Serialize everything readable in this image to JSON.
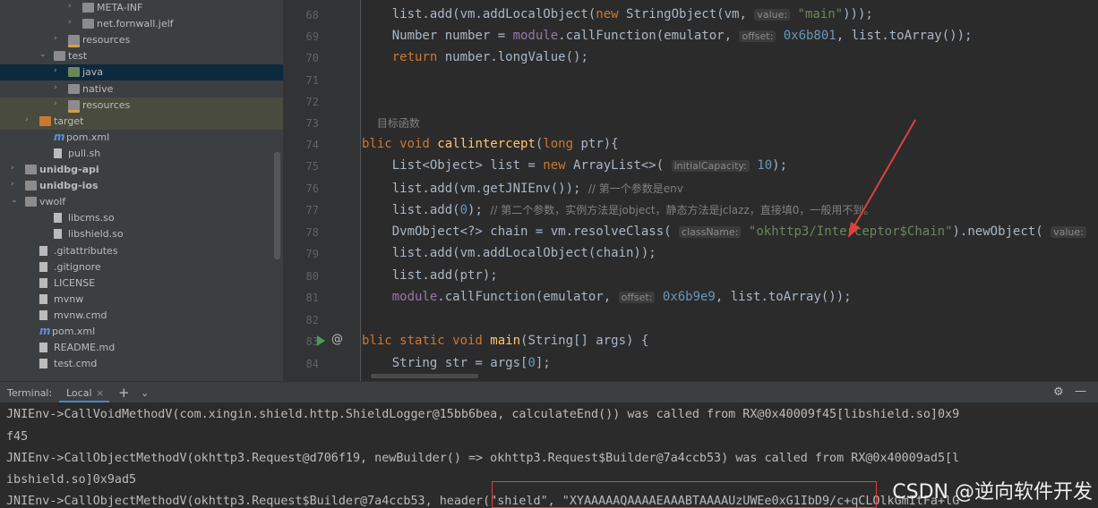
{
  "project_tree": [
    {
      "label": "META-INF",
      "indent": 92,
      "type": "folder",
      "arrow": "›"
    },
    {
      "label": "net.fornwall.jelf",
      "indent": 92,
      "type": "folder",
      "arrow": "›"
    },
    {
      "label": "resources",
      "indent": 76,
      "type": "res",
      "arrow": "›"
    },
    {
      "label": "test",
      "indent": 60,
      "type": "folder",
      "arrow": "⌄"
    },
    {
      "label": "java",
      "indent": 76,
      "type": "green",
      "arrow": "›",
      "sel": true
    },
    {
      "label": "native",
      "indent": 76,
      "type": "folder",
      "arrow": "›"
    },
    {
      "label": "resources",
      "indent": 76,
      "type": "res",
      "arrow": "›",
      "hl": true
    },
    {
      "label": "target",
      "indent": 44,
      "type": "orange",
      "arrow": "›",
      "hl": true
    },
    {
      "label": "pom.xml",
      "indent": 60,
      "type": "m"
    },
    {
      "label": "pull.sh",
      "indent": 60,
      "type": "file"
    },
    {
      "label": "unidbg-api",
      "indent": 28,
      "type": "folder",
      "arrow": "›",
      "bold": true
    },
    {
      "label": "unidbg-ios",
      "indent": 28,
      "type": "folder",
      "arrow": "›",
      "bold": true
    },
    {
      "label": "vwolf",
      "indent": 28,
      "type": "folder",
      "arrow": "⌄"
    },
    {
      "label": "libcms.so",
      "indent": 60,
      "type": "file"
    },
    {
      "label": "libshield.so",
      "indent": 60,
      "type": "file"
    },
    {
      "label": ".gitattributes",
      "indent": 44,
      "type": "file"
    },
    {
      "label": ".gitignore",
      "indent": 44,
      "type": "file"
    },
    {
      "label": "LICENSE",
      "indent": 44,
      "type": "file"
    },
    {
      "label": "mvnw",
      "indent": 44,
      "type": "file"
    },
    {
      "label": "mvnw.cmd",
      "indent": 44,
      "type": "file"
    },
    {
      "label": "pom.xml",
      "indent": 44,
      "type": "m"
    },
    {
      "label": "README.md",
      "indent": 44,
      "type": "file"
    },
    {
      "label": "test.cmd",
      "indent": 44,
      "type": "file"
    }
  ],
  "editor": {
    "line_numbers": [
      "68",
      "69",
      "70",
      "71",
      "72",
      "73",
      "74",
      "75",
      "76",
      "77",
      "78",
      "79",
      "80",
      "81",
      "82",
      "83",
      "84"
    ],
    "comment_73": "目标函数",
    "hint_value": "value:",
    "hint_offset": "offset:",
    "hint_capacity": "initialCapacity:",
    "hint_classname": "className:",
    "str_main": "\"main\"",
    "str_chain": "\"okhttp3/Interceptor$Chain\"",
    "num_6b801": "0x6b801",
    "num_6b9e9": "0x6b9e9",
    "num_10": "10",
    "num_0": "0",
    "comment_76": "// 第一个参数是env",
    "comment_77": "// 第二个参数，实例方法是jobject，静态方法是jclazz，直接填0，一般用不到。",
    "fn_callintercept": "callintercept",
    "fn_main": "main"
  },
  "terminal": {
    "title": "Terminal:",
    "tab": "Local",
    "lines": [
      "JNIEnv->CallVoidMethodV(com.xingin.shield.http.ShieldLogger@15bb6bea, calculateEnd()) was called from RX@0x40009f45[libshield.so]0x9",
      "f45",
      "JNIEnv->CallObjectMethodV(okhttp3.Request@d706f19, newBuilder() => okhttp3.Request$Builder@7a4ccb53) was called from RX@0x40009ad5[l",
      "ibshield.so]0x9ad5",
      "JNIEnv->CallObjectMethodV(okhttp3.Request$Builder@7a4ccb53, header(\"shield\", \"XYAAAAAQAAAAEAAABTAAAAUzUWEe0xG1IbD9/c+qCLOlkGmItFa+lG"
    ]
  },
  "watermark": "CSDN @逆向软件开发"
}
